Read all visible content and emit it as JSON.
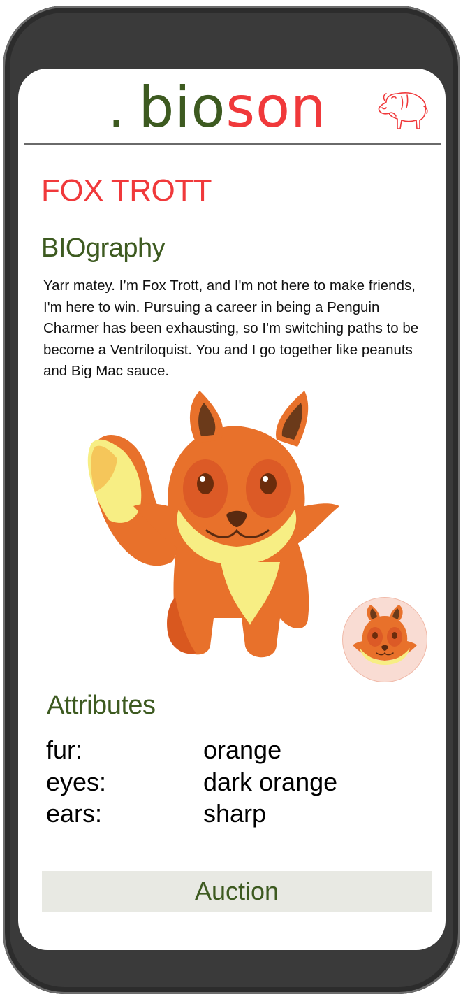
{
  "brand": {
    "dot": ".",
    "part1": "bio",
    "part2": "son",
    "colors": {
      "green": "#3d5a20",
      "red": "#f0393b"
    },
    "icon": "bison-icon"
  },
  "profile": {
    "name": "FOX TROTT",
    "bio_heading": "BIOgraphy",
    "bio_text": "Yarr matey. I’m Fox Trott, and I'm not here to make friends, I'm here to win. Pursuing a career in being a Penguin Charmer has been exhausting, so I'm switching paths to be become a Ventriloquist. You and I go together like peanuts and Big Mac sauce.",
    "image_icon": "fox-illustration",
    "avatar_icon": "fox-face-avatar"
  },
  "attributes": {
    "heading": "Attributes",
    "rows": [
      {
        "key": "fur:",
        "value": "orange"
      },
      {
        "key": "eyes:",
        "value": "dark orange"
      },
      {
        "key": "ears:",
        "value": "sharp"
      }
    ]
  },
  "actions": {
    "auction_label": "Auction"
  }
}
